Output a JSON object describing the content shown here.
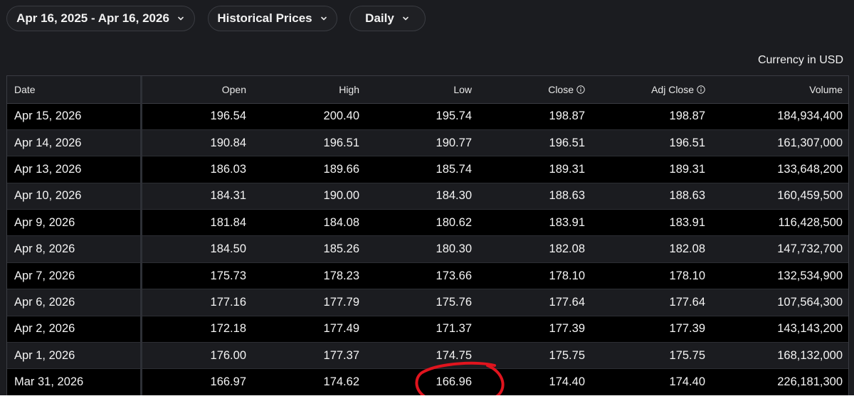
{
  "toolbar": {
    "date_range": "Apr 16, 2025 - Apr 16, 2026",
    "data_type": "Historical Prices",
    "frequency": "Daily"
  },
  "currency_note": "Currency in USD",
  "table": {
    "headers": {
      "date": "Date",
      "open": "Open",
      "high": "High",
      "low": "Low",
      "close": "Close",
      "adj_close": "Adj Close",
      "volume": "Volume"
    },
    "rows": [
      {
        "date": "Apr 15, 2026",
        "open": "196.54",
        "high": "200.40",
        "low": "195.74",
        "close": "198.87",
        "adj_close": "198.87",
        "volume": "184,934,400"
      },
      {
        "date": "Apr 14, 2026",
        "open": "190.84",
        "high": "196.51",
        "low": "190.77",
        "close": "196.51",
        "adj_close": "196.51",
        "volume": "161,307,000"
      },
      {
        "date": "Apr 13, 2026",
        "open": "186.03",
        "high": "189.66",
        "low": "185.74",
        "close": "189.31",
        "adj_close": "189.31",
        "volume": "133,648,200"
      },
      {
        "date": "Apr 10, 2026",
        "open": "184.31",
        "high": "190.00",
        "low": "184.30",
        "close": "188.63",
        "adj_close": "188.63",
        "volume": "160,459,500"
      },
      {
        "date": "Apr 9, 2026",
        "open": "181.84",
        "high": "184.08",
        "low": "180.62",
        "close": "183.91",
        "adj_close": "183.91",
        "volume": "116,428,500"
      },
      {
        "date": "Apr 8, 2026",
        "open": "184.50",
        "high": "185.26",
        "low": "180.30",
        "close": "182.08",
        "adj_close": "182.08",
        "volume": "147,732,700"
      },
      {
        "date": "Apr 7, 2026",
        "open": "175.73",
        "high": "178.23",
        "low": "173.66",
        "close": "178.10",
        "adj_close": "178.10",
        "volume": "132,534,900"
      },
      {
        "date": "Apr 6, 2026",
        "open": "177.16",
        "high": "177.79",
        "low": "175.76",
        "close": "177.64",
        "adj_close": "177.64",
        "volume": "107,564,300"
      },
      {
        "date": "Apr 2, 2026",
        "open": "172.18",
        "high": "177.49",
        "low": "171.37",
        "close": "177.39",
        "adj_close": "177.39",
        "volume": "143,143,200"
      },
      {
        "date": "Apr 1, 2026",
        "open": "176.00",
        "high": "177.37",
        "low": "174.75",
        "close": "175.75",
        "adj_close": "175.75",
        "volume": "168,132,000"
      },
      {
        "date": "Mar 31, 2026",
        "open": "166.97",
        "high": "174.62",
        "low": "166.96",
        "close": "174.40",
        "adj_close": "174.40",
        "volume": "226,181,300"
      }
    ]
  },
  "annotation": {
    "circle_color": "#e0141e"
  },
  "icons": {
    "dropdown": "chevron-down-icon",
    "info": "info-icon"
  },
  "colors": {
    "background": "#1b1c20",
    "row_alt": "#000000",
    "border": "#3a3c42",
    "text": "#f4f4f4"
  }
}
